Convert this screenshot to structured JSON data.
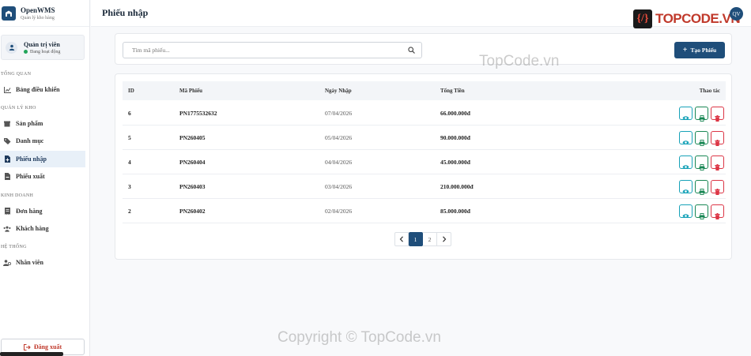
{
  "brand": {
    "name": "OpenWMS",
    "subtitle": "Quản lý kho hàng"
  },
  "user": {
    "name": "Quản trị viên",
    "status": "Đang hoạt động",
    "initials": "QV"
  },
  "sidebar": {
    "sections": [
      {
        "label": "TỔNG QUAN"
      },
      {
        "label": "QUẢN LÝ KHO"
      },
      {
        "label": "KINH DOANH"
      },
      {
        "label": "HỆ THỐNG"
      }
    ],
    "items": [
      {
        "label": "Bảng điều khiển",
        "icon": "chart-line-icon"
      },
      {
        "label": "Sản phẩm",
        "icon": "box-icon"
      },
      {
        "label": "Danh mục",
        "icon": "tags-icon"
      },
      {
        "label": "Phiếu nhập",
        "icon": "file-import-icon",
        "active": true
      },
      {
        "label": "Phiếu xuất",
        "icon": "file-export-icon"
      },
      {
        "label": "Đơn hàng",
        "icon": "receipt-icon"
      },
      {
        "label": "Khách hàng",
        "icon": "users-icon"
      },
      {
        "label": "Nhân viên",
        "icon": "user-tie-icon"
      }
    ],
    "logout_label": "Đăng xuất"
  },
  "header": {
    "title": "Phiếu nhập",
    "logo_text": "TOPCODE.VN"
  },
  "search": {
    "placeholder": "Tìm mã phiếu...",
    "value": ""
  },
  "create_button": {
    "label": "Tạo Phiếu"
  },
  "table": {
    "columns": [
      "ID",
      "Mã Phiếu",
      "Ngày Nhập",
      "Tổng Tiền",
      "Thao tác"
    ],
    "rows": [
      {
        "id": "6",
        "code": "PN1775532632",
        "date": "07/04/2026",
        "total": "66.000.000đ"
      },
      {
        "id": "5",
        "code": "PN260405",
        "date": "05/04/2026",
        "total": "90.000.000đ"
      },
      {
        "id": "4",
        "code": "PN260404",
        "date": "04/04/2026",
        "total": "45.000.000đ"
      },
      {
        "id": "3",
        "code": "PN260403",
        "date": "03/04/2026",
        "total": "210.000.000đ"
      },
      {
        "id": "2",
        "code": "PN260402",
        "date": "02/04/2026",
        "total": "85.000.000đ"
      }
    ]
  },
  "pagination": {
    "pages": [
      "1",
      "2"
    ],
    "current": "1",
    "prev": "‹",
    "next": "›"
  },
  "watermark": {
    "text": "TopCode.vn",
    "copyright": "Copyright © TopCode.vn"
  },
  "colors": {
    "primary": "#1f4e7a",
    "view": "#17a2b8",
    "print": "#198754",
    "delete": "#dc3545",
    "status": "#22a55a"
  }
}
